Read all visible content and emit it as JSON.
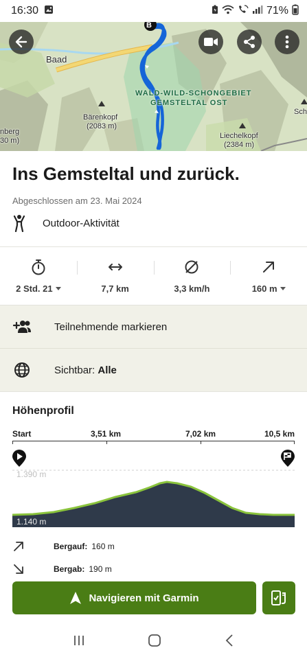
{
  "status_bar": {
    "time": "16:30",
    "battery": "71%"
  },
  "map": {
    "labels": {
      "baad": "Baad",
      "reserve_line1": "WALD-WILD-SCHONGEBIET",
      "reserve_line2": "GEMSTELTAL OST",
      "barenkopf": "Bärenkopf",
      "barenkopf_elev": "(2083 m)",
      "liechelkopf": "Liechelkopf",
      "liechelkopf_elev": "(2384 m)",
      "left_peak": "nberg",
      "left_peak_elev": "30 m)",
      "right_peak": "Sch",
      "end_marker": "B"
    },
    "colors": {
      "route": "#1565d8",
      "road": "#f3d774",
      "reserve": "#9fd6ad"
    }
  },
  "activity": {
    "title": "Ins Gemsteltal und zurück.",
    "completed": "Abgeschlossen am 23. Mai 2024",
    "type": "Outdoor-Aktivität"
  },
  "stats": [
    {
      "icon": "stopwatch-icon",
      "value": "2 Std. 21",
      "has_dropdown": true
    },
    {
      "icon": "distance-icon",
      "value": "7,7 km",
      "has_dropdown": false
    },
    {
      "icon": "speed-icon",
      "value": "3,3 km/h",
      "has_dropdown": false
    },
    {
      "icon": "ascent-icon",
      "value": "160 m",
      "has_dropdown": true
    }
  ],
  "rows": {
    "participants": "Teilnehmende markieren",
    "visibility_label": "Sichtbar:",
    "visibility_value": "Alle"
  },
  "elevation": {
    "title": "Höhenprofil",
    "distance_labels": [
      "Start",
      "3,51 km",
      "7,02 km",
      "10,5 km"
    ],
    "max_label": "1.390 m",
    "min_label": "1.140 m",
    "ascent_label": "Bergauf:",
    "ascent_value": "160 m",
    "descent_label": "Bergab:",
    "descent_value": "190 m"
  },
  "actions": {
    "navigate": "Navigieren mit Garmin"
  },
  "theme": {
    "accent": "#4a7d15",
    "profile_fill": "#2f3a4a",
    "profile_line": "#8ac33c"
  }
}
